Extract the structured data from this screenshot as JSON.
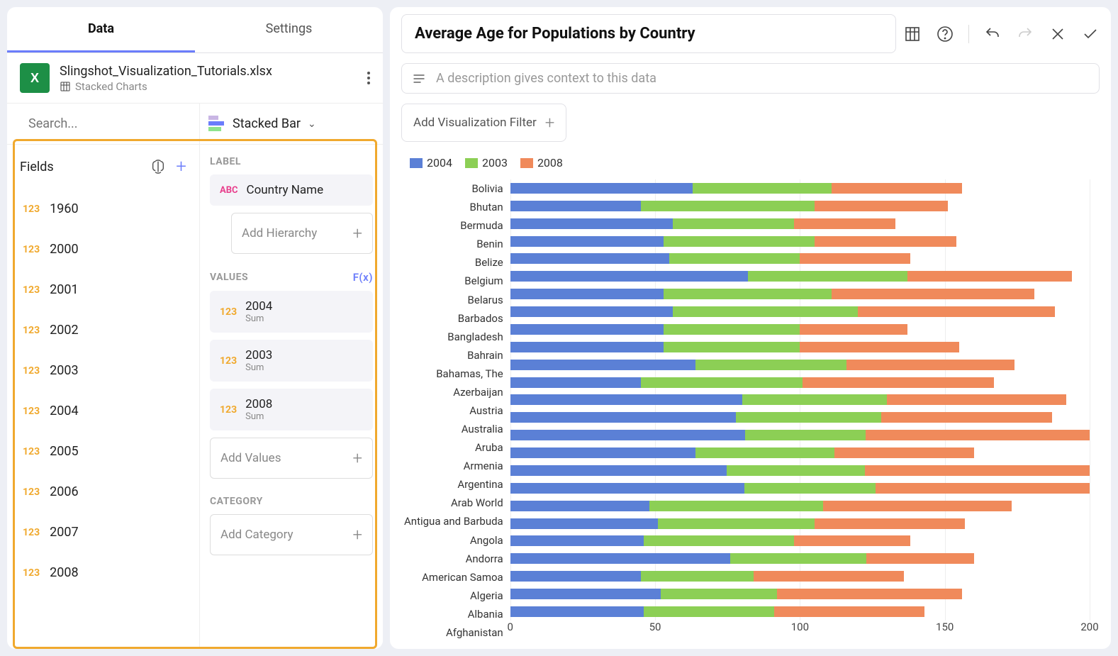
{
  "tabs": {
    "data": "Data",
    "settings": "Settings"
  },
  "file": {
    "name": "Slingshot_Visualization_Tutorials.xlsx",
    "subtitle": "Stacked Charts"
  },
  "search": {
    "placeholder": "Search..."
  },
  "vistype": {
    "label": "Stacked Bar"
  },
  "fields_header": "Fields",
  "fields": [
    "1960",
    "2000",
    "2001",
    "2002",
    "2003",
    "2004",
    "2005",
    "2006",
    "2007",
    "2008"
  ],
  "config": {
    "label_section": "LABEL",
    "label_chip": "Country Name",
    "add_hierarchy": "Add Hierarchy",
    "values_section": "VALUES",
    "fx": "F(x)",
    "values": [
      {
        "name": "2004",
        "agg": "Sum"
      },
      {
        "name": "2003",
        "agg": "Sum"
      },
      {
        "name": "2008",
        "agg": "Sum"
      }
    ],
    "add_values": "Add Values",
    "category_section": "CATEGORY",
    "add_category": "Add Category"
  },
  "viz": {
    "title": "Average Age for Populations by Country",
    "desc_placeholder": "A description gives context to this data",
    "filter_label": "Add Visualization Filter"
  },
  "legend_colors": {
    "2004": "#5b80d6",
    "2003": "#8ccf55",
    "2008": "#f08a5b"
  },
  "chart_data": {
    "type": "bar",
    "orientation": "horizontal",
    "stacked": true,
    "title": "Average Age for Populations by Country",
    "xlabel": "",
    "ylabel": "",
    "xlim": [
      0,
      200
    ],
    "xticks": [
      0,
      50,
      100,
      150,
      200
    ],
    "legend": [
      "2004",
      "2003",
      "2008"
    ],
    "categories": [
      "Bolivia",
      "Bhutan",
      "Bermuda",
      "Benin",
      "Belize",
      "Belgium",
      "Belarus",
      "Barbados",
      "Bangladesh",
      "Bahrain",
      "Bahamas, The",
      "Azerbaijan",
      "Austria",
      "Australia",
      "Aruba",
      "Armenia",
      "Argentina",
      "Arab World",
      "Antigua and Barbuda",
      "Angola",
      "Andorra",
      "American Samoa",
      "Algeria",
      "Albania",
      "Afghanistan"
    ],
    "series": [
      {
        "name": "2004",
        "color": "#5b80d6",
        "values": [
          63,
          45,
          56,
          53,
          55,
          82,
          53,
          56,
          53,
          53,
          64,
          45,
          80,
          78,
          82,
          64,
          75,
          82,
          48,
          51,
          46,
          76,
          45,
          52,
          46
        ]
      },
      {
        "name": "2003",
        "color": "#8ccf55",
        "values": [
          48,
          60,
          42,
          52,
          45,
          55,
          58,
          64,
          47,
          47,
          52,
          56,
          50,
          50,
          42,
          48,
          48,
          46,
          60,
          54,
          52,
          47,
          39,
          40,
          45
        ]
      },
      {
        "name": "2008",
        "color": "#f08a5b",
        "values": [
          45,
          46,
          35,
          49,
          38,
          57,
          70,
          68,
          37,
          55,
          58,
          66,
          62,
          59,
          78,
          48,
          78,
          75,
          65,
          52,
          40,
          37,
          52,
          64,
          52
        ]
      }
    ]
  }
}
